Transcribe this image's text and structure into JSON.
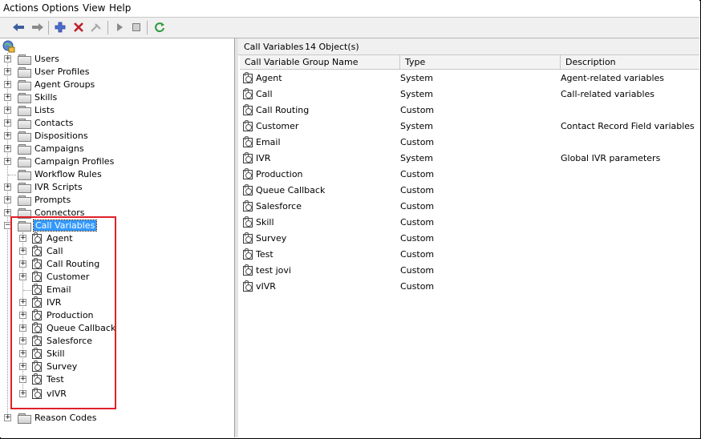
{
  "menubar": {
    "items": [
      "Actions",
      "Options",
      "View",
      "Help"
    ]
  },
  "toolbar": {
    "icons": [
      "back-arrow-icon",
      "forward-arrow-icon",
      "add-icon",
      "delete-icon",
      "disabled-tool-icon",
      "play-icon",
      "stop-icon",
      "refresh-icon"
    ]
  },
  "tree": {
    "items": [
      {
        "label": "Users"
      },
      {
        "label": "User Profiles"
      },
      {
        "label": "Agent Groups"
      },
      {
        "label": "Skills"
      },
      {
        "label": "Lists"
      },
      {
        "label": "Contacts"
      },
      {
        "label": "Dispositions"
      },
      {
        "label": "Campaigns"
      },
      {
        "label": "Campaign Profiles"
      },
      {
        "label": "Workflow Rules"
      },
      {
        "label": "IVR Scripts"
      },
      {
        "label": "Prompts"
      },
      {
        "label": "Connectors"
      },
      {
        "label": "Call Variables"
      },
      {
        "label": "Reason Codes"
      }
    ],
    "children": [
      "Agent",
      "Call",
      "Call Routing",
      "Customer",
      "Email",
      "IVR",
      "Production",
      "Queue Callback",
      "Salesforce",
      "Skill",
      "Survey",
      "Test",
      "vIVR"
    ]
  },
  "panel": {
    "title": "Call Variables",
    "count": "14 Object(s)",
    "columns": [
      "Call Variable Group Name",
      "Type",
      "Description"
    ],
    "rows": [
      [
        "Agent",
        "System",
        "Agent-related variables"
      ],
      [
        "Call",
        "System",
        "Call-related variables"
      ],
      [
        "Call Routing",
        "Custom",
        ""
      ],
      [
        "Customer",
        "System",
        "Contact Record Field variables"
      ],
      [
        "Email",
        "Custom",
        ""
      ],
      [
        "IVR",
        "System",
        "Global IVR parameters"
      ],
      [
        "Production",
        "Custom",
        ""
      ],
      [
        "Queue Callback",
        "Custom",
        ""
      ],
      [
        "Salesforce",
        "Custom",
        ""
      ],
      [
        "Skill",
        "Custom",
        ""
      ],
      [
        "Survey",
        "Custom",
        ""
      ],
      [
        "Test",
        "Custom",
        ""
      ],
      [
        "test jovi",
        "Custom",
        ""
      ],
      [
        "vIVR",
        "Custom",
        ""
      ]
    ]
  },
  "colors": {
    "selection": "#3399ff",
    "highlight_box": "#e0202a"
  }
}
